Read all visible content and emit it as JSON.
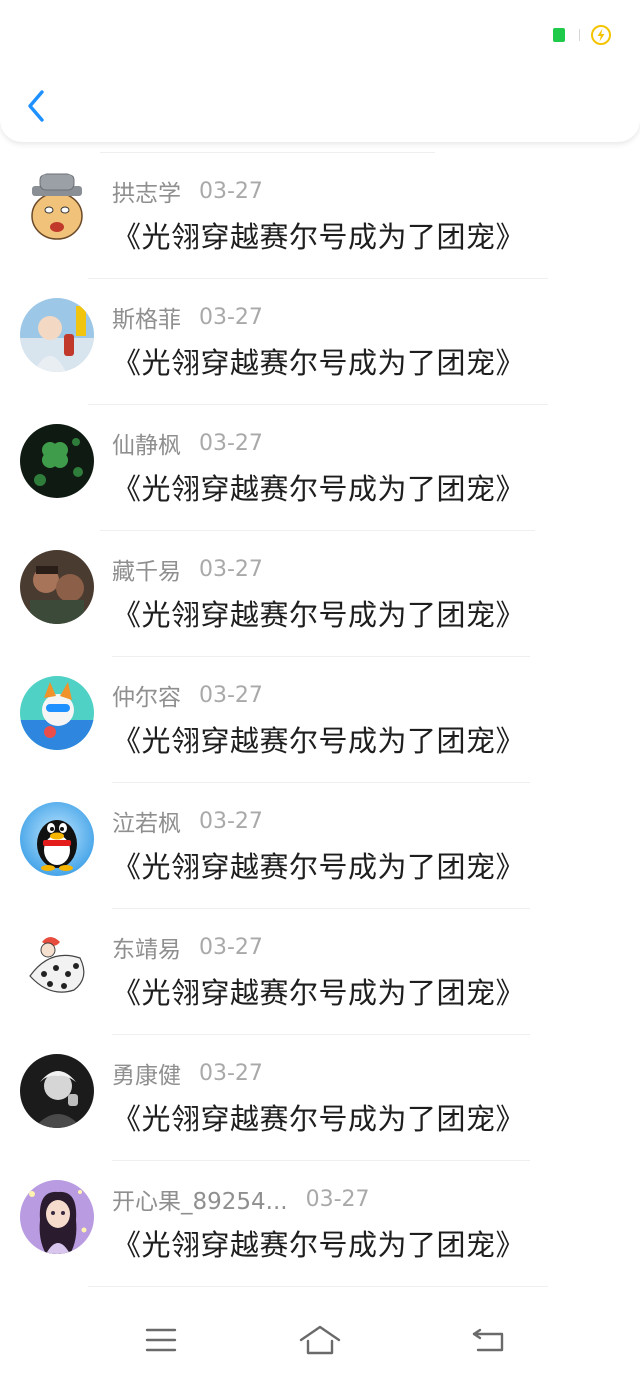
{
  "colors": {
    "accent": "#1e90ff",
    "signal": "#1fc94a",
    "charge": "#f5c400",
    "username": "#8f8f8f",
    "date": "#a9a9a9",
    "comment": "#1e1e1e"
  },
  "header": {
    "back_icon": "chevron-left-icon",
    "status_icons": [
      "signal-indicator",
      "charging-icon"
    ]
  },
  "comments": [
    {
      "username": "拱志学",
      "date": "03-27",
      "text": "《光翎穿越赛尔号成为了团宠》",
      "avatar": "cartoon-old-man-hat"
    },
    {
      "username": "斯格菲",
      "date": "03-27",
      "text": "《光翎穿越赛尔号成为了团宠》",
      "avatar": "girl-with-drink-photo"
    },
    {
      "username": "仙静枫",
      "date": "03-27",
      "text": "《光翎穿越赛尔号成为了团宠》",
      "avatar": "clover-leaves-dark"
    },
    {
      "username": "藏千易",
      "date": "03-27",
      "text": "《光翎穿越赛尔号成为了团宠》",
      "avatar": "movie-still-men"
    },
    {
      "username": "仲尔容",
      "date": "03-27",
      "text": "《光翎穿越赛尔号成为了团宠》",
      "avatar": "cartoon-fox-character"
    },
    {
      "username": "泣若枫",
      "date": "03-27",
      "text": "《光翎穿越赛尔号成为了团宠》",
      "avatar": "qq-penguin"
    },
    {
      "username": "东靖易",
      "date": "03-27",
      "text": "《光翎穿越赛尔号成为了团宠》",
      "avatar": "polka-dot-cartoon"
    },
    {
      "username": "勇康健",
      "date": "03-27",
      "text": "《光翎穿越赛尔号成为了团宠》",
      "avatar": "black-white-portrait"
    },
    {
      "username": "开心果_89254...",
      "date": "03-27",
      "text": "《光翎穿越赛尔号成为了团宠》",
      "avatar": "anime-girl-purple"
    }
  ],
  "navbar": {
    "icons": [
      "menu-icon",
      "home-icon",
      "back-icon"
    ]
  }
}
